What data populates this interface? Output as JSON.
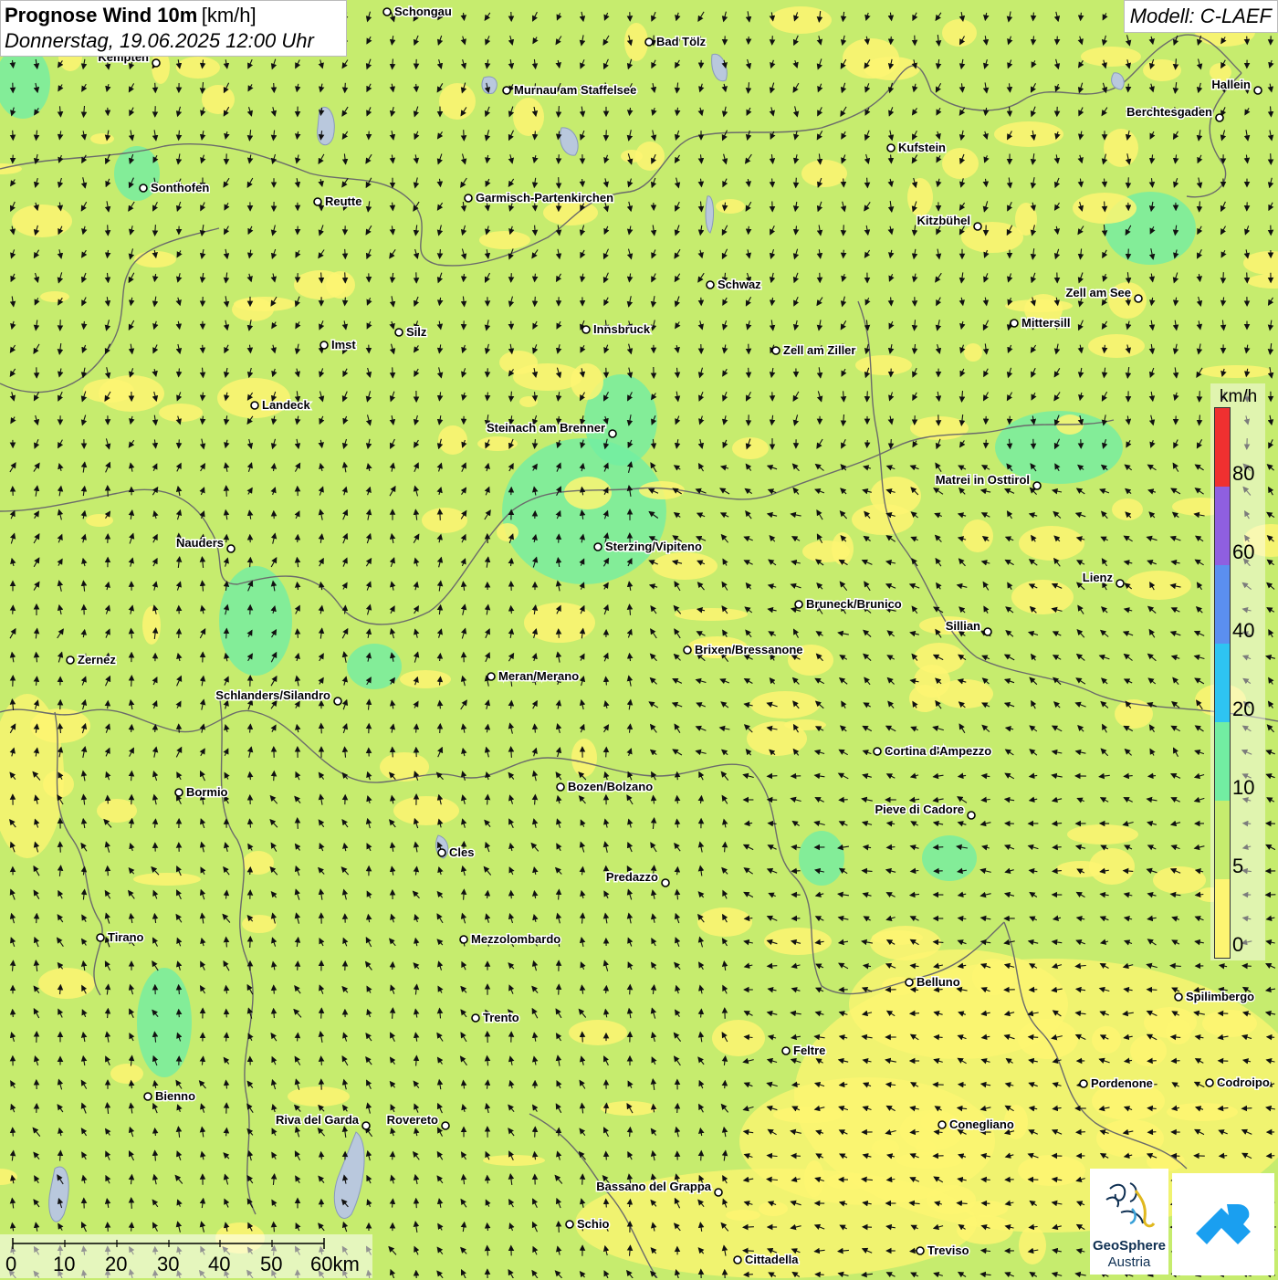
{
  "title": {
    "main": "Prognose Wind 10m",
    "unit": "[km/h]",
    "date": "Donnerstag, 19.06.2025 12:00 Uhr"
  },
  "model": "Modell: C-LAEF",
  "legend": {
    "unit": "km/h",
    "labels": [
      "80",
      "60",
      "40",
      "20",
      "10",
      "5",
      "0"
    ],
    "colors": [
      "#f03030",
      "#8f5fe0",
      "#5b8ff0",
      "#2ec4f2",
      "#72eda2",
      "#c6ec6e",
      "#fdf572"
    ]
  },
  "scale": {
    "labels": [
      "0",
      "10",
      "20",
      "30",
      "40",
      "50",
      "60km"
    ]
  },
  "logo": {
    "name": "GeoSphere",
    "sub": "Austria"
  },
  "cities": [
    {
      "name": "Schongau"
    },
    {
      "name": "Bad Tölz"
    },
    {
      "name": "Kempten"
    },
    {
      "name": "Murnau am Staffelsee"
    },
    {
      "name": "Hallein"
    },
    {
      "name": "Berchtesgaden"
    },
    {
      "name": "Kufstein"
    },
    {
      "name": "Sonthofen"
    },
    {
      "name": "Reutte"
    },
    {
      "name": "Garmisch-Partenkirchen"
    },
    {
      "name": "Kitzbühel"
    },
    {
      "name": "Schwaz"
    },
    {
      "name": "Zell am See"
    },
    {
      "name": "Mittersill"
    },
    {
      "name": "Innsbruck"
    },
    {
      "name": "Silz"
    },
    {
      "name": "Imst"
    },
    {
      "name": "Zell am Ziller"
    },
    {
      "name": "Landeck"
    },
    {
      "name": "Steinach am Brenner"
    },
    {
      "name": "Matrei in Osttirol"
    },
    {
      "name": "Nauders"
    },
    {
      "name": "Sterzing/Vipiteno"
    },
    {
      "name": "Lienz"
    },
    {
      "name": "Bruneck/Brunico"
    },
    {
      "name": "Sillian"
    },
    {
      "name": "Zernez"
    },
    {
      "name": "Brixen/Bressanone"
    },
    {
      "name": "Meran/Merano"
    },
    {
      "name": "Schlanders/Silandro"
    },
    {
      "name": "Cortina d'Ampezzo"
    },
    {
      "name": "Bozen/Bolzano"
    },
    {
      "name": "Bormio"
    },
    {
      "name": "Pieve di Cadore"
    },
    {
      "name": "Cles"
    },
    {
      "name": "Predazzo"
    },
    {
      "name": "Tirano"
    },
    {
      "name": "Mezzolombardo"
    },
    {
      "name": "Belluno"
    },
    {
      "name": "Spilimbergo"
    },
    {
      "name": "Trento"
    },
    {
      "name": "Feltre"
    },
    {
      "name": "Bienno"
    },
    {
      "name": "Pordenone"
    },
    {
      "name": "Codroipo"
    },
    {
      "name": "Riva del Garda"
    },
    {
      "name": "Rovereto"
    },
    {
      "name": "Conegliano"
    },
    {
      "name": "Bassano del Grappa"
    },
    {
      "name": "Schio"
    },
    {
      "name": "Treviso"
    },
    {
      "name": "Cittadella"
    }
  ]
}
